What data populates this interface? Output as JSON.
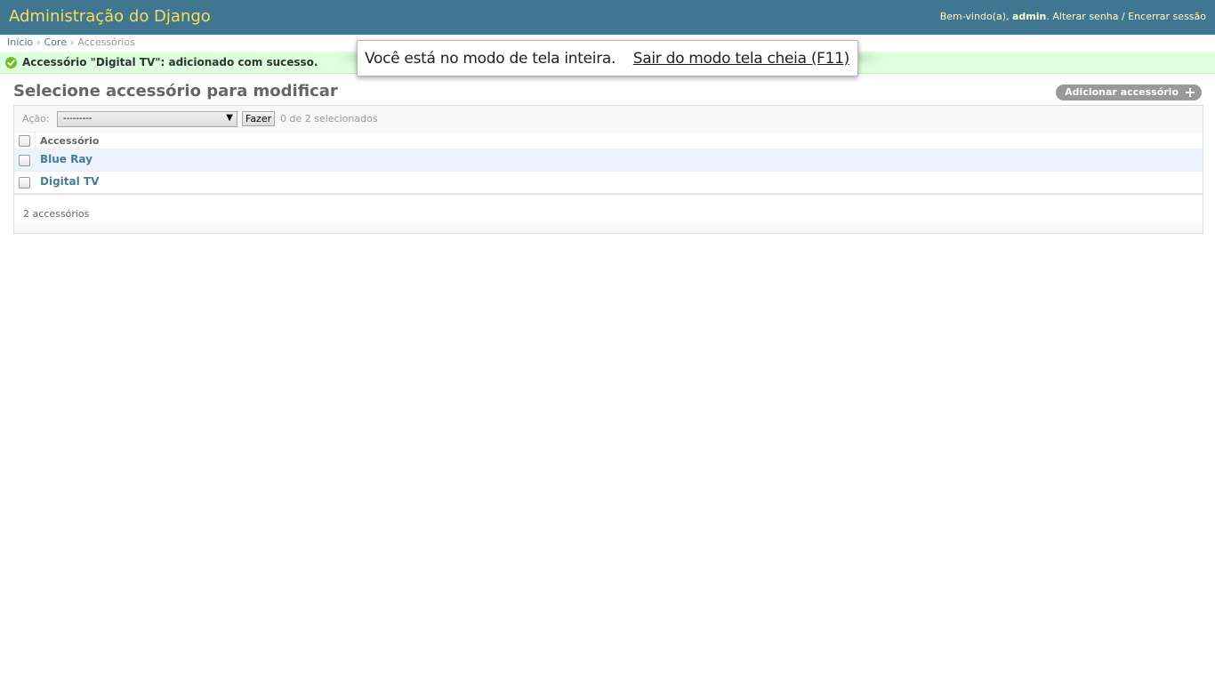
{
  "header": {
    "branding": "Administração do Django",
    "welcome": "Bem-vindo(a), ",
    "username": "admin",
    "change_password": "Alterar senha",
    "separator": " / ",
    "logout": "Encerrar sessão"
  },
  "breadcrumbs": {
    "home": "Início",
    "app": "Core",
    "current": "Accessórios",
    "separator": "›"
  },
  "message": {
    "type": "success",
    "icon": "check-circle-icon",
    "text": "Accessório \"Digital TV\": adicionado com sucesso."
  },
  "fullscreen_notice": {
    "text": "Você está no modo de tela inteira.",
    "exit_link": "Sair do modo tela cheia (F11)"
  },
  "main": {
    "title": "Selecione accessório para modificar",
    "add_button": "Adicionar accessório",
    "add_icon": "plus-icon"
  },
  "actions": {
    "label": "Ação:",
    "selected_option": "---------",
    "go_button": "Fazer",
    "counter": "0 de 2 selecionados"
  },
  "table": {
    "column_header": "Accessório",
    "rows": [
      {
        "label": "Blue Ray"
      },
      {
        "label": "Digital TV"
      }
    ]
  },
  "paginator": {
    "count": "2 accessórios"
  },
  "colors": {
    "header_bg": "#417690",
    "branding": "#f5dd5d",
    "link": "#447e9b",
    "success_bg": "#dddfdd",
    "row_alt": "#edf3fe"
  }
}
